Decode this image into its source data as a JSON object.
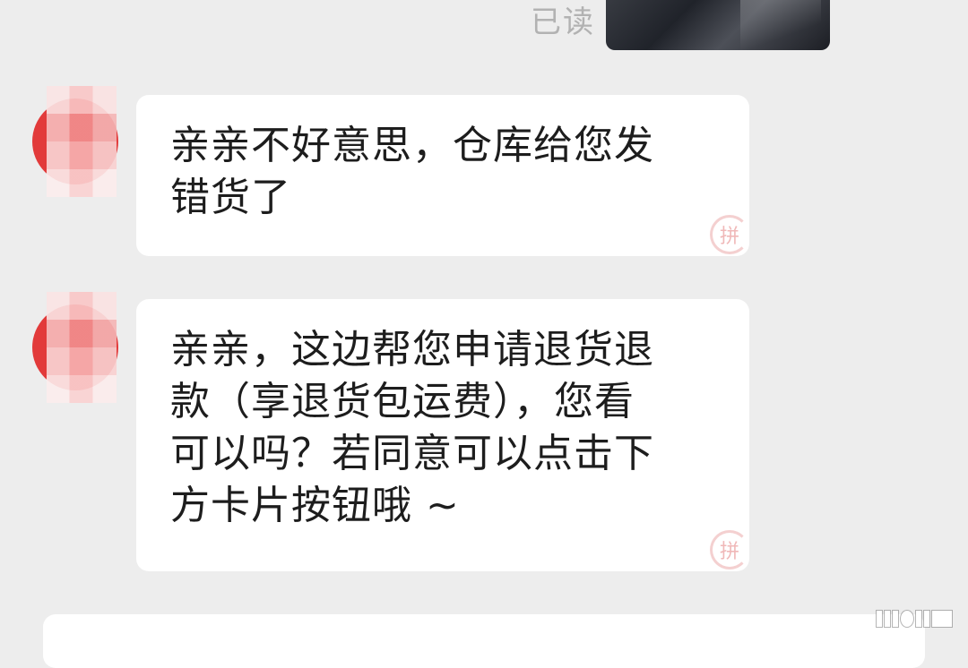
{
  "read_status": "已读",
  "thumbnail_icon": "image-thumbnail",
  "messages": [
    {
      "sender": "other",
      "text": "亲亲不好意思，仓库给您发\n错货了",
      "stamp": "拼"
    },
    {
      "sender": "other",
      "text": "亲亲，这边帮您申请退货退\n款（享退货包运费），您看\n可以吗？若同意可以点击下\n方卡片按钮哦 ~",
      "stamp": "拼"
    }
  ],
  "colors": {
    "background": "#ededed",
    "bubble": "#ffffff",
    "text": "#1d1d1d",
    "read_status": "#b2b2b2",
    "avatar": "#e23a3a"
  }
}
